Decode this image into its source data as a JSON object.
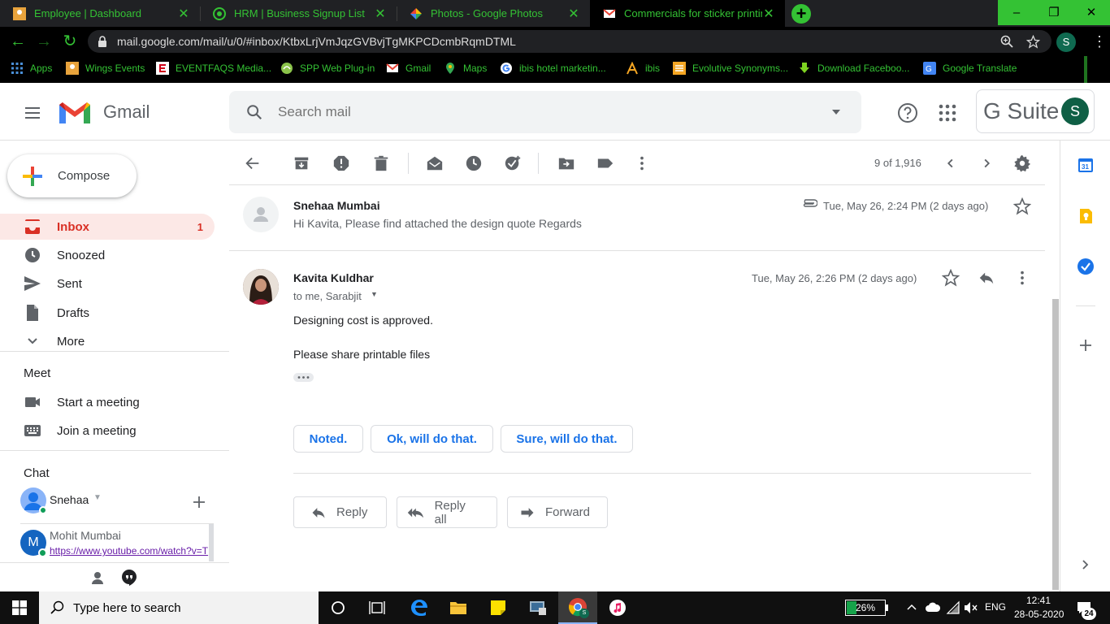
{
  "browser": {
    "tabs": [
      {
        "title": "Employee | Dashboard",
        "icon": "employee-favicon"
      },
      {
        "title": "HRM | Business Signup List",
        "icon": "hrm-favicon"
      },
      {
        "title": "Photos - Google Photos",
        "icon": "photos-favicon"
      },
      {
        "title": "Commercials for sticker printing",
        "icon": "gmail-favicon"
      }
    ],
    "url": "mail.google.com/mail/u/0/#inbox/KtbxLrjVmJqzGVBvjTgMKPCDcmbRqmDTML",
    "profile_initial": "S",
    "bookmarks": [
      {
        "label": "Apps",
        "icon": "apps-grid-icon",
        "color": "#4a90d9"
      },
      {
        "label": "Wings Events",
        "icon": "wings-events-icon",
        "color": "#e8a33c"
      },
      {
        "label": "EVENTFAQS Media...",
        "icon": "eventfaqs-icon",
        "color": "#d0021b"
      },
      {
        "label": "SPP Web Plug-in",
        "icon": "spp-plugin-icon",
        "color": "#8bc34a"
      },
      {
        "label": "Gmail",
        "icon": "gmail-icon",
        "color": "#ea4335"
      },
      {
        "label": "Maps",
        "icon": "maps-icon",
        "color": "#34a853"
      },
      {
        "label": "ibis hotel marketin...",
        "icon": "google-g-icon",
        "color": "#ffffff"
      },
      {
        "label": "ibis",
        "icon": "ibis-icon",
        "color": "#f5a623"
      },
      {
        "label": "Evolutive Synonyms...",
        "icon": "evolutive-icon",
        "color": "#f5a623"
      },
      {
        "label": "Download Faceboo...",
        "icon": "download-arrow-icon",
        "color": "#7ed321"
      },
      {
        "label": "Google Translate",
        "icon": "translate-icon",
        "color": "#4285f4"
      }
    ]
  },
  "gmail": {
    "logo_text": "Gmail",
    "search_placeholder": "Search mail",
    "gsuite_label": "G Suite",
    "avatar_initial": "S",
    "compose_label": "Compose",
    "nav": [
      {
        "label": "Inbox",
        "count": "1",
        "icon": "inbox-icon"
      },
      {
        "label": "Snoozed",
        "icon": "clock-icon"
      },
      {
        "label": "Sent",
        "icon": "send-icon"
      },
      {
        "label": "Drafts",
        "icon": "draft-icon"
      },
      {
        "label": "More",
        "icon": "chevron-down-icon"
      }
    ],
    "meet": {
      "heading": "Meet",
      "items": [
        {
          "label": "Start a meeting",
          "icon": "video-camera-icon"
        },
        {
          "label": "Join a meeting",
          "icon": "keyboard-icon"
        }
      ]
    },
    "chat": {
      "heading": "Chat",
      "self_name": "Snehaa",
      "contacts": [
        {
          "name": "Mohit Mumbai",
          "initial": "M",
          "snippet": "https://www.youtube.com/watch?v=T"
        }
      ]
    },
    "pager": "9 of 1,916",
    "messages": [
      {
        "sender": "Snehaa Mumbai",
        "snippet": "Hi Kavita, Please find attached the design quote Regards",
        "date": "Tue, May 26, 2:24 PM (2 days ago)"
      },
      {
        "sender": "Kavita Kuldhar",
        "recipients": "to me, Sarabjit",
        "date": "Tue, May 26, 2:26 PM (2 days ago)",
        "body": [
          "Designing cost is approved.",
          "Please share printable files"
        ]
      }
    ],
    "smart_replies": [
      "Noted.",
      "Ok, will do that.",
      "Sure, will do that."
    ],
    "actions": {
      "reply": "Reply",
      "reply_all": "Reply all",
      "forward": "Forward"
    },
    "colors": {
      "accent": "#1a73e8",
      "inbox_highlight": "#fce8e6",
      "inbox_text": "#d93025"
    }
  },
  "taskbar": {
    "search_placeholder": "Type here to search",
    "battery": "26%",
    "language": "ENG",
    "time": "12:41",
    "date": "28-05-2020",
    "notification_count": "24"
  }
}
